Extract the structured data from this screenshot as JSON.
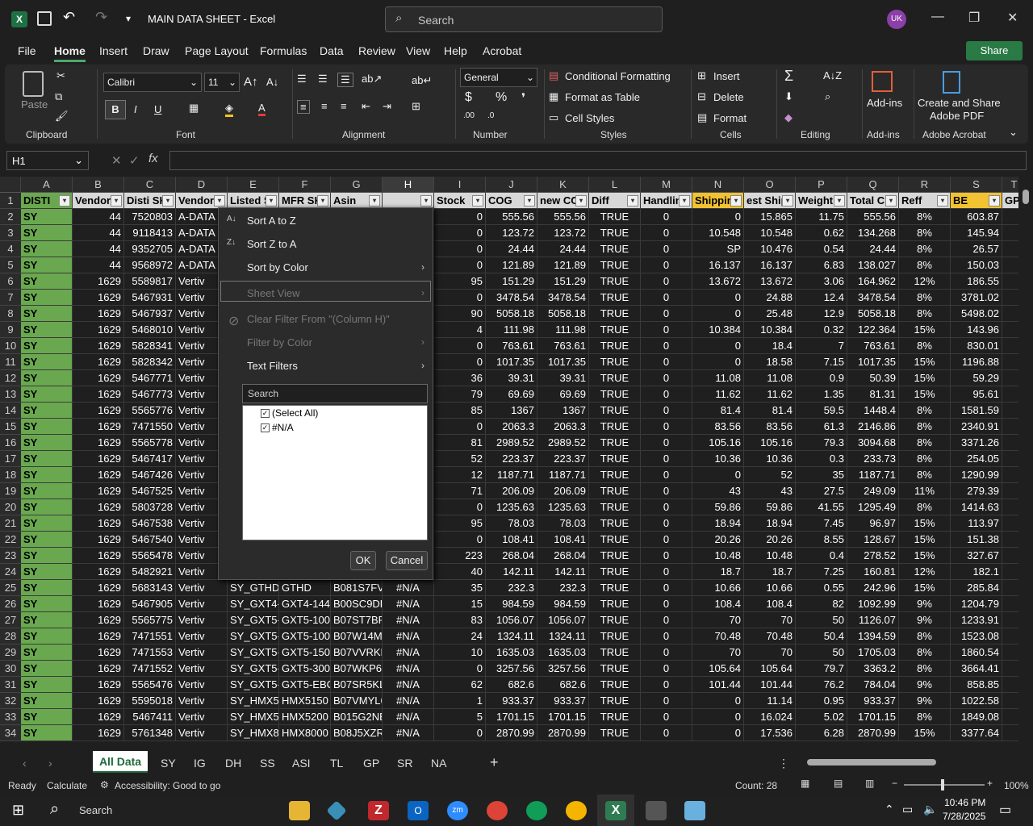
{
  "window": {
    "title": "MAIN DATA SHEET  -  Excel",
    "search_placeholder": "Search",
    "avatar": "UK"
  },
  "menu": [
    "File",
    "Home",
    "Insert",
    "Draw",
    "Page Layout",
    "Formulas",
    "Data",
    "Review",
    "View",
    "Help",
    "Acrobat"
  ],
  "share": "Share",
  "ribbon": {
    "clipboard": {
      "label": "Clipboard",
      "paste": "Paste"
    },
    "font": {
      "label": "Font",
      "name": "Calibri",
      "size": "11"
    },
    "alignment": {
      "label": "Alignment"
    },
    "number": {
      "label": "Number",
      "format": "General"
    },
    "styles": {
      "label": "Styles",
      "cond": "Conditional Formatting",
      "table": "Format as Table",
      "cell": "Cell Styles"
    },
    "cells": {
      "label": "Cells",
      "insert": "Insert",
      "delete": "Delete",
      "format": "Format"
    },
    "editing": {
      "label": "Editing"
    },
    "addins": {
      "label": "Add-ins",
      "btn": "Add-ins"
    },
    "acrobat": {
      "label": "Adobe Acrobat",
      "btn1": "Create and Share",
      "btn2": "Adobe PDF"
    }
  },
  "namebox": "H1",
  "columns": [
    "A",
    "B",
    "C",
    "D",
    "E",
    "F",
    "G",
    "H",
    "I",
    "J",
    "K",
    "L",
    "M",
    "N",
    "O",
    "P",
    "Q",
    "R",
    "S",
    "T"
  ],
  "headers": [
    "DISTI",
    "Vendor",
    "Disti SK",
    "Vendor",
    "Listed S",
    "MFR SK",
    "Asin",
    "",
    "Stock",
    "COG",
    "new CC",
    "Diff",
    "Handlin",
    "Shippin",
    "est Ship",
    "Weight",
    "Total C",
    "Reff",
    "BE",
    "GP"
  ],
  "rows": [
    [
      "2",
      "SY",
      "44",
      "7520803",
      "A-DATA",
      "",
      "",
      "",
      "",
      "0",
      "555.56",
      "555.56",
      "TRUE",
      "0",
      "0",
      "15.865",
      "11.75",
      "555.56",
      "8%",
      "603.87"
    ],
    [
      "3",
      "SY",
      "44",
      "9118413",
      "A-DATA",
      "",
      "",
      "",
      "",
      "0",
      "123.72",
      "123.72",
      "TRUE",
      "0",
      "10.548",
      "10.548",
      "0.62",
      "134.268",
      "8%",
      "145.94"
    ],
    [
      "4",
      "SY",
      "44",
      "9352705",
      "A-DATA",
      "",
      "",
      "",
      "",
      "0",
      "24.44",
      "24.44",
      "TRUE",
      "0",
      "SP",
      "10.476",
      "0.54",
      "24.44",
      "8%",
      "26.57"
    ],
    [
      "5",
      "SY",
      "44",
      "9568972",
      "A-DATA",
      "",
      "",
      "",
      "",
      "0",
      "121.89",
      "121.89",
      "TRUE",
      "0",
      "16.137",
      "16.137",
      "6.83",
      "138.027",
      "8%",
      "150.03"
    ],
    [
      "6",
      "SY",
      "1629",
      "5589817",
      "Vertiv",
      "",
      "",
      "",
      "",
      "95",
      "151.29",
      "151.29",
      "TRUE",
      "0",
      "13.672",
      "13.672",
      "3.06",
      "164.962",
      "12%",
      "186.55"
    ],
    [
      "7",
      "SY",
      "1629",
      "5467931",
      "Vertiv",
      "",
      "",
      "",
      "",
      "0",
      "3478.54",
      "3478.54",
      "TRUE",
      "0",
      "0",
      "24.88",
      "12.4",
      "3478.54",
      "8%",
      "3781.02"
    ],
    [
      "8",
      "SY",
      "1629",
      "5467937",
      "Vertiv",
      "",
      "",
      "",
      "",
      "90",
      "5058.18",
      "5058.18",
      "TRUE",
      "0",
      "0",
      "25.48",
      "12.9",
      "5058.18",
      "8%",
      "5498.02"
    ],
    [
      "9",
      "SY",
      "1629",
      "5468010",
      "Vertiv",
      "",
      "",
      "",
      "",
      "4",
      "111.98",
      "111.98",
      "TRUE",
      "0",
      "10.384",
      "10.384",
      "0.32",
      "122.364",
      "15%",
      "143.96"
    ],
    [
      "10",
      "SY",
      "1629",
      "5828341",
      "Vertiv",
      "",
      "",
      "",
      "",
      "0",
      "763.61",
      "763.61",
      "TRUE",
      "0",
      "0",
      "18.4",
      "7",
      "763.61",
      "8%",
      "830.01"
    ],
    [
      "11",
      "SY",
      "1629",
      "5828342",
      "Vertiv",
      "",
      "",
      "",
      "",
      "0",
      "1017.35",
      "1017.35",
      "TRUE",
      "0",
      "0",
      "18.58",
      "7.15",
      "1017.35",
      "15%",
      "1196.88"
    ],
    [
      "12",
      "SY",
      "1629",
      "5467771",
      "Vertiv",
      "",
      "",
      "",
      "",
      "36",
      "39.31",
      "39.31",
      "TRUE",
      "0",
      "11.08",
      "11.08",
      "0.9",
      "50.39",
      "15%",
      "59.29"
    ],
    [
      "13",
      "SY",
      "1629",
      "5467773",
      "Vertiv",
      "",
      "",
      "",
      "",
      "79",
      "69.69",
      "69.69",
      "TRUE",
      "0",
      "11.62",
      "11.62",
      "1.35",
      "81.31",
      "15%",
      "95.61"
    ],
    [
      "14",
      "SY",
      "1629",
      "5565776",
      "Vertiv",
      "",
      "",
      "",
      "",
      "85",
      "1367",
      "1367",
      "TRUE",
      "0",
      "81.4",
      "81.4",
      "59.5",
      "1448.4",
      "8%",
      "1581.59"
    ],
    [
      "15",
      "SY",
      "1629",
      "7471550",
      "Vertiv",
      "",
      "",
      "",
      "",
      "0",
      "2063.3",
      "2063.3",
      "TRUE",
      "0",
      "83.56",
      "83.56",
      "61.3",
      "2146.86",
      "8%",
      "2340.91"
    ],
    [
      "16",
      "SY",
      "1629",
      "5565778",
      "Vertiv",
      "",
      "",
      "",
      "",
      "81",
      "2989.52",
      "2989.52",
      "TRUE",
      "0",
      "105.16",
      "105.16",
      "79.3",
      "3094.68",
      "8%",
      "3371.26"
    ],
    [
      "17",
      "SY",
      "1629",
      "5467417",
      "Vertiv",
      "",
      "",
      "",
      "",
      "52",
      "223.37",
      "223.37",
      "TRUE",
      "0",
      "10.36",
      "10.36",
      "0.3",
      "233.73",
      "8%",
      "254.05"
    ],
    [
      "18",
      "SY",
      "1629",
      "5467426",
      "Vertiv",
      "",
      "",
      "",
      "",
      "12",
      "1187.71",
      "1187.71",
      "TRUE",
      "0",
      "0",
      "52",
      "35",
      "1187.71",
      "8%",
      "1290.99"
    ],
    [
      "19",
      "SY",
      "1629",
      "5467525",
      "Vertiv",
      "",
      "",
      "",
      "",
      "71",
      "206.09",
      "206.09",
      "TRUE",
      "0",
      "43",
      "43",
      "27.5",
      "249.09",
      "11%",
      "279.39"
    ],
    [
      "20",
      "SY",
      "1629",
      "5803728",
      "Vertiv",
      "",
      "",
      "",
      "",
      "0",
      "1235.63",
      "1235.63",
      "TRUE",
      "0",
      "59.86",
      "59.86",
      "41.55",
      "1295.49",
      "8%",
      "1414.63"
    ],
    [
      "21",
      "SY",
      "1629",
      "5467538",
      "Vertiv",
      "",
      "",
      "",
      "",
      "95",
      "78.03",
      "78.03",
      "TRUE",
      "0",
      "18.94",
      "18.94",
      "7.45",
      "96.97",
      "15%",
      "113.97"
    ],
    [
      "22",
      "SY",
      "1629",
      "5467540",
      "Vertiv",
      "",
      "",
      "",
      "",
      "0",
      "108.41",
      "108.41",
      "TRUE",
      "0",
      "20.26",
      "20.26",
      "8.55",
      "128.67",
      "15%",
      "151.38"
    ],
    [
      "23",
      "SY",
      "1629",
      "5565478",
      "Vertiv",
      "",
      "",
      "",
      "",
      "223",
      "268.04",
      "268.04",
      "TRUE",
      "0",
      "10.48",
      "10.48",
      "0.4",
      "278.52",
      "15%",
      "327.67"
    ],
    [
      "24",
      "SY",
      "1629",
      "5482921",
      "Vertiv",
      "",
      "",
      "",
      "",
      "40",
      "142.11",
      "142.11",
      "TRUE",
      "0",
      "18.7",
      "18.7",
      "7.25",
      "160.81",
      "12%",
      "182.1"
    ],
    [
      "25",
      "SY",
      "1629",
      "5683143",
      "Vertiv",
      "SY_GTHD",
      "GTHD",
      "B081S7FV",
      "#N/A",
      "35",
      "232.3",
      "232.3",
      "TRUE",
      "0",
      "10.66",
      "10.66",
      "0.55",
      "242.96",
      "15%",
      "285.84"
    ],
    [
      "26",
      "SY",
      "1629",
      "5467905",
      "Vertiv",
      "SY_GXT4-1",
      "GXT4-144",
      "B00SC9DP",
      "#N/A",
      "15",
      "984.59",
      "984.59",
      "TRUE",
      "0",
      "108.4",
      "108.4",
      "82",
      "1092.99",
      "9%",
      "1204.79"
    ],
    [
      "27",
      "SY",
      "1629",
      "5565775",
      "Vertiv",
      "SY_GXT5-1",
      "GXT5-100",
      "B07ST7BF",
      "#N/A",
      "83",
      "1056.07",
      "1056.07",
      "TRUE",
      "0",
      "70",
      "70",
      "50",
      "1126.07",
      "9%",
      "1233.91"
    ],
    [
      "28",
      "SY",
      "1629",
      "7471551",
      "Vertiv",
      "SY_GXT5-1",
      "GXT5-100",
      "B07W14M",
      "#N/A",
      "24",
      "1324.11",
      "1324.11",
      "TRUE",
      "0",
      "70.48",
      "70.48",
      "50.4",
      "1394.59",
      "8%",
      "1523.08"
    ],
    [
      "29",
      "SY",
      "1629",
      "7471553",
      "Vertiv",
      "SY_GXT5-1",
      "GXT5-150",
      "B07VVRKL",
      "#N/A",
      "10",
      "1635.03",
      "1635.03",
      "TRUE",
      "0",
      "70",
      "70",
      "50",
      "1705.03",
      "8%",
      "1860.54"
    ],
    [
      "30",
      "SY",
      "1629",
      "7471552",
      "Vertiv",
      "SY_GXT5-3",
      "GXT5-300",
      "B07WKP6",
      "#N/A",
      "0",
      "3257.56",
      "3257.56",
      "TRUE",
      "0",
      "105.64",
      "105.64",
      "79.7",
      "3363.2",
      "8%",
      "3664.41"
    ],
    [
      "31",
      "SY",
      "1629",
      "5565476",
      "Vertiv",
      "SY_GXT5-E",
      "GXT5-EBC",
      "B07SR5KL",
      "#N/A",
      "62",
      "682.6",
      "682.6",
      "TRUE",
      "0",
      "101.44",
      "101.44",
      "76.2",
      "784.04",
      "9%",
      "858.85"
    ],
    [
      "32",
      "SY",
      "1629",
      "5595018",
      "Vertiv",
      "SY_HMX51",
      "HMX5150",
      "B07VMYL6",
      "#N/A",
      "1",
      "933.37",
      "933.37",
      "TRUE",
      "0",
      "0",
      "11.14",
      "0.95",
      "933.37",
      "9%",
      "1022.58"
    ],
    [
      "33",
      "SY",
      "1629",
      "5467411",
      "Vertiv",
      "SY_HMX52",
      "HMX5200",
      "B015G2NE",
      "#N/A",
      "5",
      "1701.15",
      "1701.15",
      "TRUE",
      "0",
      "0",
      "16.024",
      "5.02",
      "1701.15",
      "8%",
      "1849.08"
    ],
    [
      "34",
      "SY",
      "1629",
      "5761348",
      "Vertiv",
      "SY_HMX80",
      "HMX8000",
      "B08J5XZR",
      "#N/A",
      "0",
      "2870.99",
      "2870.99",
      "TRUE",
      "0",
      "0",
      "17.536",
      "6.28",
      "2870.99",
      "15%",
      "3377.64"
    ]
  ],
  "filter": {
    "sort_az": "Sort A to Z",
    "sort_za": "Sort Z to A",
    "sort_color": "Sort by Color",
    "sheet_view": "Sheet View",
    "clear": "Clear Filter From \"(Column H)\"",
    "filter_color": "Filter by Color",
    "text_filters": "Text Filters",
    "search": "Search",
    "select_all": "(Select All)",
    "na": "#N/A",
    "ok": "OK",
    "cancel": "Cancel"
  },
  "sheets": [
    "All Data",
    "SY",
    "IG",
    "DH",
    "SS",
    "ASI",
    "TL",
    "GP",
    "SR",
    "NA"
  ],
  "status": {
    "ready": "Ready",
    "calculate": "Calculate",
    "accessibility": "Accessibility: Good to go",
    "count": "Count: 28",
    "zoom": "100%"
  },
  "taskbar": {
    "search": "Search",
    "time": "10:46 PM",
    "date": "7/28/2025"
  }
}
